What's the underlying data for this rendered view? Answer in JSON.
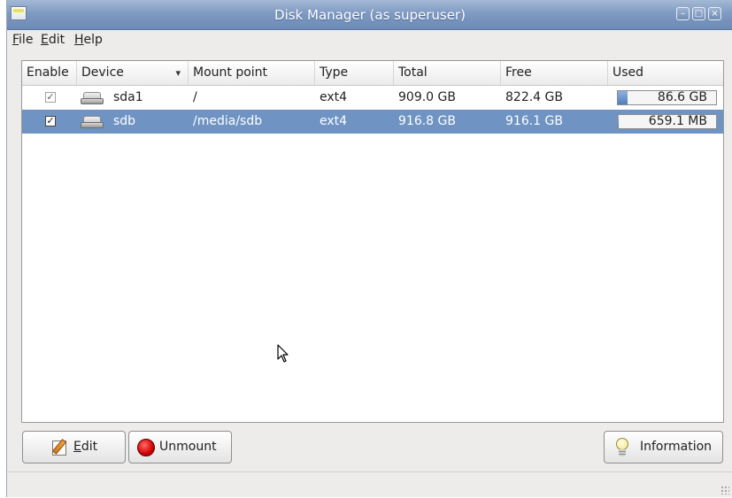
{
  "window": {
    "title": "Disk Manager (as superuser)",
    "controls": [
      "minimize-icon",
      "maximize-icon",
      "close-icon"
    ]
  },
  "menubar": {
    "items": [
      {
        "label": "File",
        "mnemonic": "F",
        "rest": "ile"
      },
      {
        "label": "Edit",
        "mnemonic": "E",
        "rest": "dit"
      },
      {
        "label": "Help",
        "mnemonic": "H",
        "rest": "elp"
      }
    ]
  },
  "table": {
    "columns": [
      "Enable",
      "Device",
      "Mount point",
      "Type",
      "Total",
      "Free",
      "Used"
    ],
    "sorted_column": "Device",
    "rows": [
      {
        "enabled": true,
        "device": "sda1",
        "mount_point": "/",
        "type": "ext4",
        "total": "909.0 GB",
        "free": "822.4 GB",
        "used": "86.6 GB",
        "used_fraction": 0.095,
        "selected": false
      },
      {
        "enabled": true,
        "device": "sdb",
        "mount_point": "/media/sdb",
        "type": "ext4",
        "total": "916.8 GB",
        "free": "916.1 GB",
        "used": "659.1 MB",
        "used_fraction": 0.001,
        "selected": true
      }
    ]
  },
  "buttons": {
    "edit": {
      "label": "Edit",
      "mnemonic": "E",
      "rest": "dit",
      "icon": "edit-icon"
    },
    "unmount": {
      "label": "Unmount",
      "icon": "stop-icon"
    },
    "information": {
      "label": "Information",
      "icon": "lightbulb-icon"
    }
  },
  "colors": {
    "titlebar": "#7f9ac2",
    "selection": "#6f93c2",
    "usage_fill": "#4f7fc0"
  }
}
